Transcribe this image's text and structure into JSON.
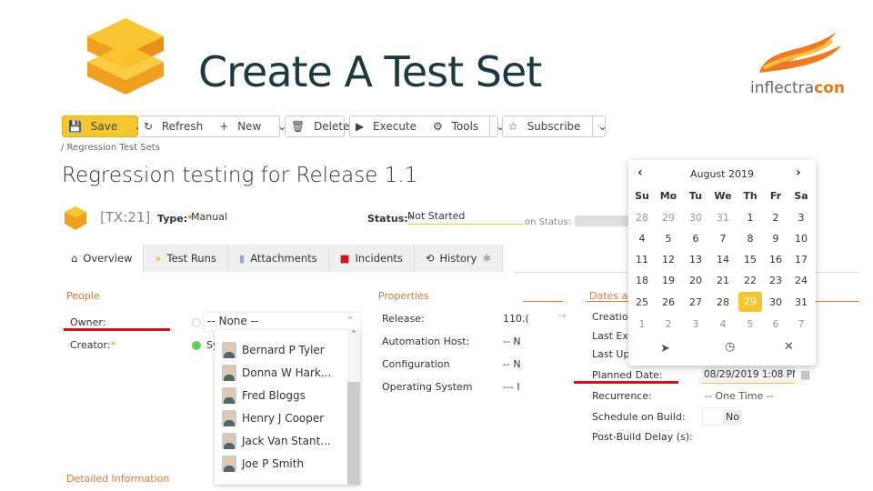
{
  "slide": {
    "title": "Create A Test Set",
    "logo_text": "inflectracon"
  },
  "toolbar": {
    "save": "Save",
    "refresh": "Refresh",
    "new": "New",
    "delete": "Delete",
    "execute": "Execute",
    "tools": "Tools",
    "subscribe": "Subscribe"
  },
  "breadcrumb": "/ Regression Test Sets",
  "page_title": "Regression testing for Release 1.1",
  "header": {
    "id": "[TX:21]",
    "type_label": "Type:",
    "type_value": "Manual",
    "status_label": "Status:",
    "status_value": "Not Started",
    "on_status_label": "on Status:"
  },
  "tabs": [
    {
      "label": "Overview"
    },
    {
      "label": "Test Runs"
    },
    {
      "label": "Attachments"
    },
    {
      "label": "Incidents"
    },
    {
      "label": "History"
    }
  ],
  "people": {
    "title": "People",
    "owner_label": "Owner:",
    "owner_value": "-- None --",
    "creator_label": "Creator:",
    "creator_value": "Sy"
  },
  "owner_dropdown": [
    "Bernard P Tyler",
    "Donna W Hark...",
    "Fred Bloggs",
    "Henry J Cooper",
    "Jack Van Stant...",
    "Joe P Smith"
  ],
  "properties": {
    "title": "Properties",
    "rows": [
      {
        "label": "Release:",
        "value": "110.("
      },
      {
        "label": "Automation Host:",
        "value": "-- N"
      },
      {
        "label": "Configuration",
        "value": "-- N"
      },
      {
        "label": "Operating System",
        "value": "--- I"
      }
    ]
  },
  "dates": {
    "title": "Dates an",
    "creation": "Creation",
    "last_exec": "Last Exe",
    "last_upd": "Last Up",
    "planned_label": "Planned Date:",
    "planned_value": "08/29/2019 1:08 PM",
    "recurrence_label": "Recurrence:",
    "recurrence_value": "-- One Time --",
    "schedule_label": "Schedule on Build:",
    "schedule_value": "No",
    "delay_label": "Post-Build Delay (s):"
  },
  "detailed": {
    "title": "Detailed Information"
  },
  "calendar": {
    "month": "August 2019",
    "weekdays": [
      "Su",
      "Mo",
      "Tu",
      "We",
      "Th",
      "Fr",
      "Sa"
    ],
    "weeks": [
      [
        "28",
        "29",
        "30",
        "31",
        "1",
        "2",
        "3"
      ],
      [
        "4",
        "5",
        "6",
        "7",
        "8",
        "9",
        "10"
      ],
      [
        "11",
        "12",
        "13",
        "14",
        "15",
        "16",
        "17"
      ],
      [
        "18",
        "19",
        "20",
        "21",
        "22",
        "23",
        "24"
      ],
      [
        "25",
        "26",
        "27",
        "28",
        "29",
        "30",
        "31"
      ],
      [
        "1",
        "2",
        "3",
        "4",
        "5",
        "6",
        "7"
      ]
    ],
    "selected": "29",
    "accent": "#f5c62e"
  }
}
